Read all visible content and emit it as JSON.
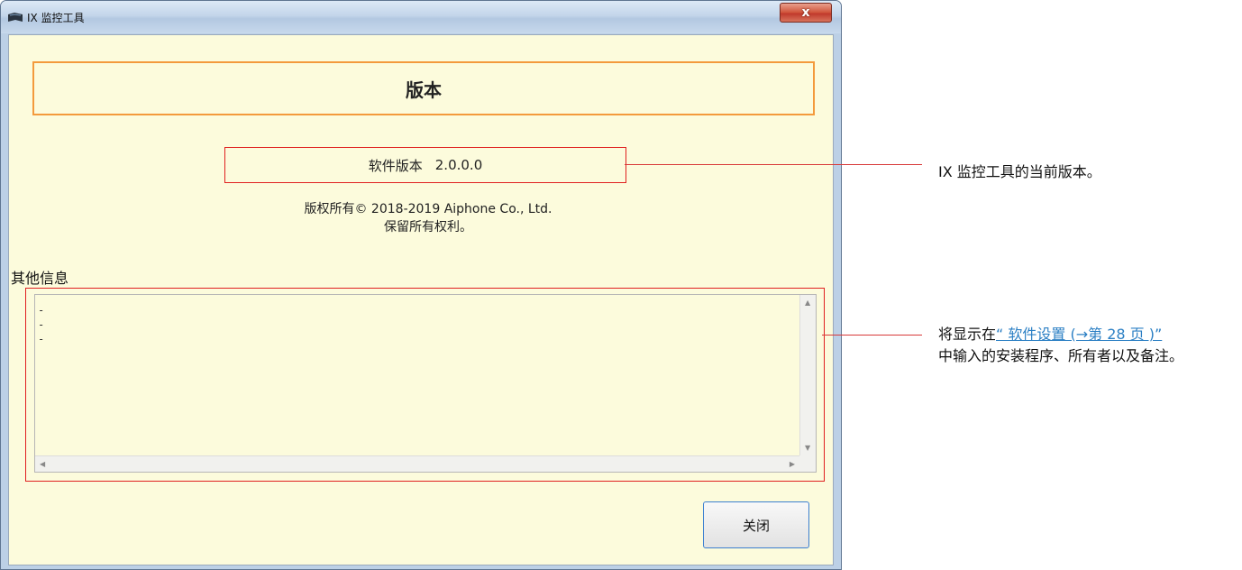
{
  "window": {
    "title": "IX 监控工具",
    "close_symbol": "x"
  },
  "dialog": {
    "header": "版本",
    "software_version_label": "软件版本",
    "software_version": "2.0.0.0",
    "copyright_line1": "版权所有© 2018-2019 Aiphone Co., Ltd.",
    "copyright_line2": "保留所有权利。",
    "other_info_label": "其他信息",
    "other_info_lines": [
      "-",
      "-",
      "-"
    ],
    "close_button_label": "关闭"
  },
  "annotations": {
    "version_note": "IX 监控工具的当前版本。",
    "info_note_prefix": "将显示在",
    "info_note_link": "“ 软件设置 (→第 28 页 )”",
    "info_note_suffix": "中输入的安装程序、所有者以及备注。"
  },
  "colors": {
    "client_bg": "#fcfbdc",
    "header_border": "#f39a3c",
    "highlight": "#e02020",
    "link": "#2b7fc4"
  }
}
